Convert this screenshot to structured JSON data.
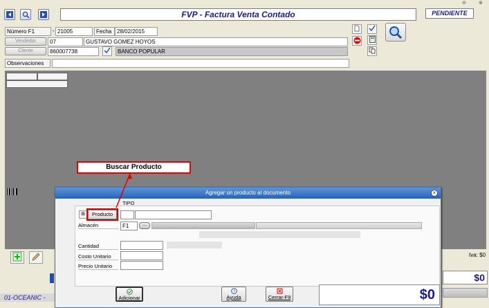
{
  "window": {
    "title": "FVP - Factura Venta Contado",
    "status": "PENDIENTE"
  },
  "header": {
    "numero_label": "Número F1",
    "numero_sep": "-",
    "numero_value": "21005",
    "fecha_label": "Fecha",
    "fecha_value": "28/02/2015",
    "vendedor_button": "Vendedor",
    "vendedor_code": "07",
    "vendedor_name": "GUSTAVO GOMEZ HOYOS",
    "cliente_button": "Cliente",
    "cliente_code": "860007738",
    "cliente_name": "BANCO POPULAR",
    "observaciones_label": "Observaciones",
    "observaciones_value": ""
  },
  "bottom": {
    "iva_label": "Iva: $0",
    "total_label": "$0",
    "company": "01-OCEANIC  -"
  },
  "dialog": {
    "title": "Agregar un  producto al documento",
    "tipo_label": "TIPO",
    "producto_button": "Producto",
    "almacen_label": "Almacén",
    "almacen_value": "F1",
    "dots_button": "...",
    "cantidad_label": "Cantidad",
    "costo_label": "Costo Unitario",
    "precio_label": "Precio Unitario",
    "adicionar_button": "Adicionar",
    "ayuda_button": "Ayuda",
    "cerrar_button": "Cerrar-F9",
    "total_value": "$0"
  },
  "callout": {
    "text": "Buscar Producto",
    "color": "#e00000"
  },
  "colors": {
    "grid_bg": "#808080",
    "title_blue": "#1a1a8c",
    "dialog_title_bg": "#3b79c8"
  }
}
